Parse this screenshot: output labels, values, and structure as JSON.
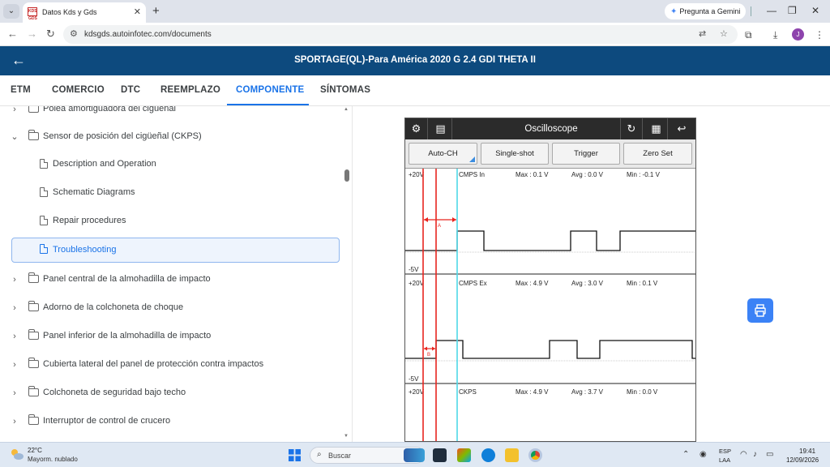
{
  "browser": {
    "tab_title": "Datos Kds y Gds",
    "favicon_text": "KDS GDS",
    "gemini_label": "Pregunta a Gemini",
    "url": "kdsgds.autoinfotec.com/documents",
    "avatar_letter": "J"
  },
  "header": {
    "title": "SPORTAGE(QL)-Para América 2020 G 2.4 GDI THETA II"
  },
  "tabs": [
    {
      "label": "ETM"
    },
    {
      "label": "COMERCIO"
    },
    {
      "label": "DTC"
    },
    {
      "label": "REEMPLAZO"
    },
    {
      "label": "COMPONENTE",
      "active": true
    },
    {
      "label": "SÍNTOMAS"
    }
  ],
  "tree": [
    {
      "label": "Polea amortiguadora del cigüeñal",
      "type": "folder",
      "expanded": false
    },
    {
      "label": "Sensor de posición del cigüeñal (CKPS)",
      "type": "folder",
      "expanded": true
    },
    {
      "label": "Description and Operation",
      "type": "doc"
    },
    {
      "label": "Schematic Diagrams",
      "type": "doc"
    },
    {
      "label": "Repair procedures",
      "type": "doc"
    },
    {
      "label": "Troubleshooting",
      "type": "doc",
      "selected": true
    },
    {
      "label": "Panel central de la almohadilla de impacto",
      "type": "folder",
      "expanded": false
    },
    {
      "label": "Adorno de la colchoneta de choque",
      "type": "folder",
      "expanded": false
    },
    {
      "label": "Panel inferior de la almohadilla de impacto",
      "type": "folder",
      "expanded": false
    },
    {
      "label": "Cubierta lateral del panel de protección contra impactos",
      "type": "folder",
      "expanded": false
    },
    {
      "label": "Colchoneta de seguridad bajo techo",
      "type": "folder",
      "expanded": false
    },
    {
      "label": "Interruptor de control de crucero",
      "type": "folder",
      "expanded": false
    }
  ],
  "oscilloscope": {
    "title": "Oscilloscope",
    "buttons": [
      "Auto-CH",
      "Single-shot",
      "Trigger",
      "Zero Set"
    ],
    "channels": [
      {
        "top_label": "+20V",
        "name": "CMPS In",
        "max": "Max : 0.1 V",
        "avg": "Avg : 0.0 V",
        "min": "Min : -0.1 V",
        "bottom_label": "-5V",
        "marker": "A"
      },
      {
        "top_label": "+20V",
        "name": "CMPS Ex",
        "max": "Max : 4.9 V",
        "avg": "Avg : 3.0 V",
        "min": "Min : 0.1 V",
        "bottom_label": "-5V",
        "marker": "B"
      },
      {
        "top_label": "+20V",
        "name": "CKPS",
        "max": "Max : 4.9 V",
        "avg": "Avg : 3.7 V",
        "min": "Min : 0.0 V",
        "bottom_label": "",
        "marker": ""
      }
    ]
  },
  "taskbar": {
    "temperature": "22°C",
    "condition": "Mayorm. nublado",
    "search_placeholder": "Buscar",
    "lang_1": "ESP",
    "lang_2": "LAA",
    "time": "19:41",
    "date": "12/09/2026"
  },
  "colors": {
    "header_bg": "#0d4a7e",
    "accent": "#1a73e8",
    "print_button": "#3b82f6",
    "cursor_red": "#e8251f",
    "cursor_cyan": "#4fd8e8"
  }
}
